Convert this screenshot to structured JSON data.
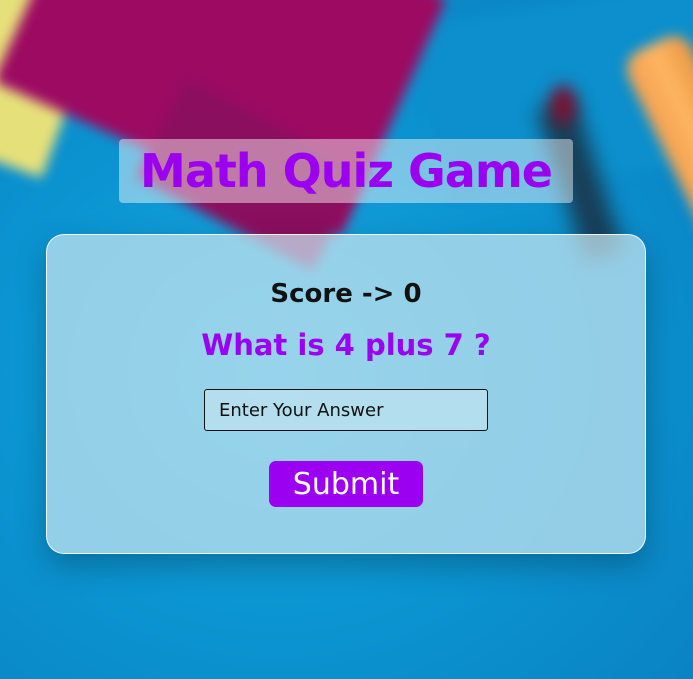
{
  "header": {
    "title": "Math Quiz Game"
  },
  "quiz": {
    "score_text": "Score -> 0",
    "question": "What is 4 plus 7 ?",
    "answer_placeholder": "Enter Your Answer",
    "answer_value": "",
    "submit_label": "Submit"
  },
  "colors": {
    "accent": "#9b00f0",
    "card": "#c8e6f0",
    "background": "#0a9ad6"
  }
}
